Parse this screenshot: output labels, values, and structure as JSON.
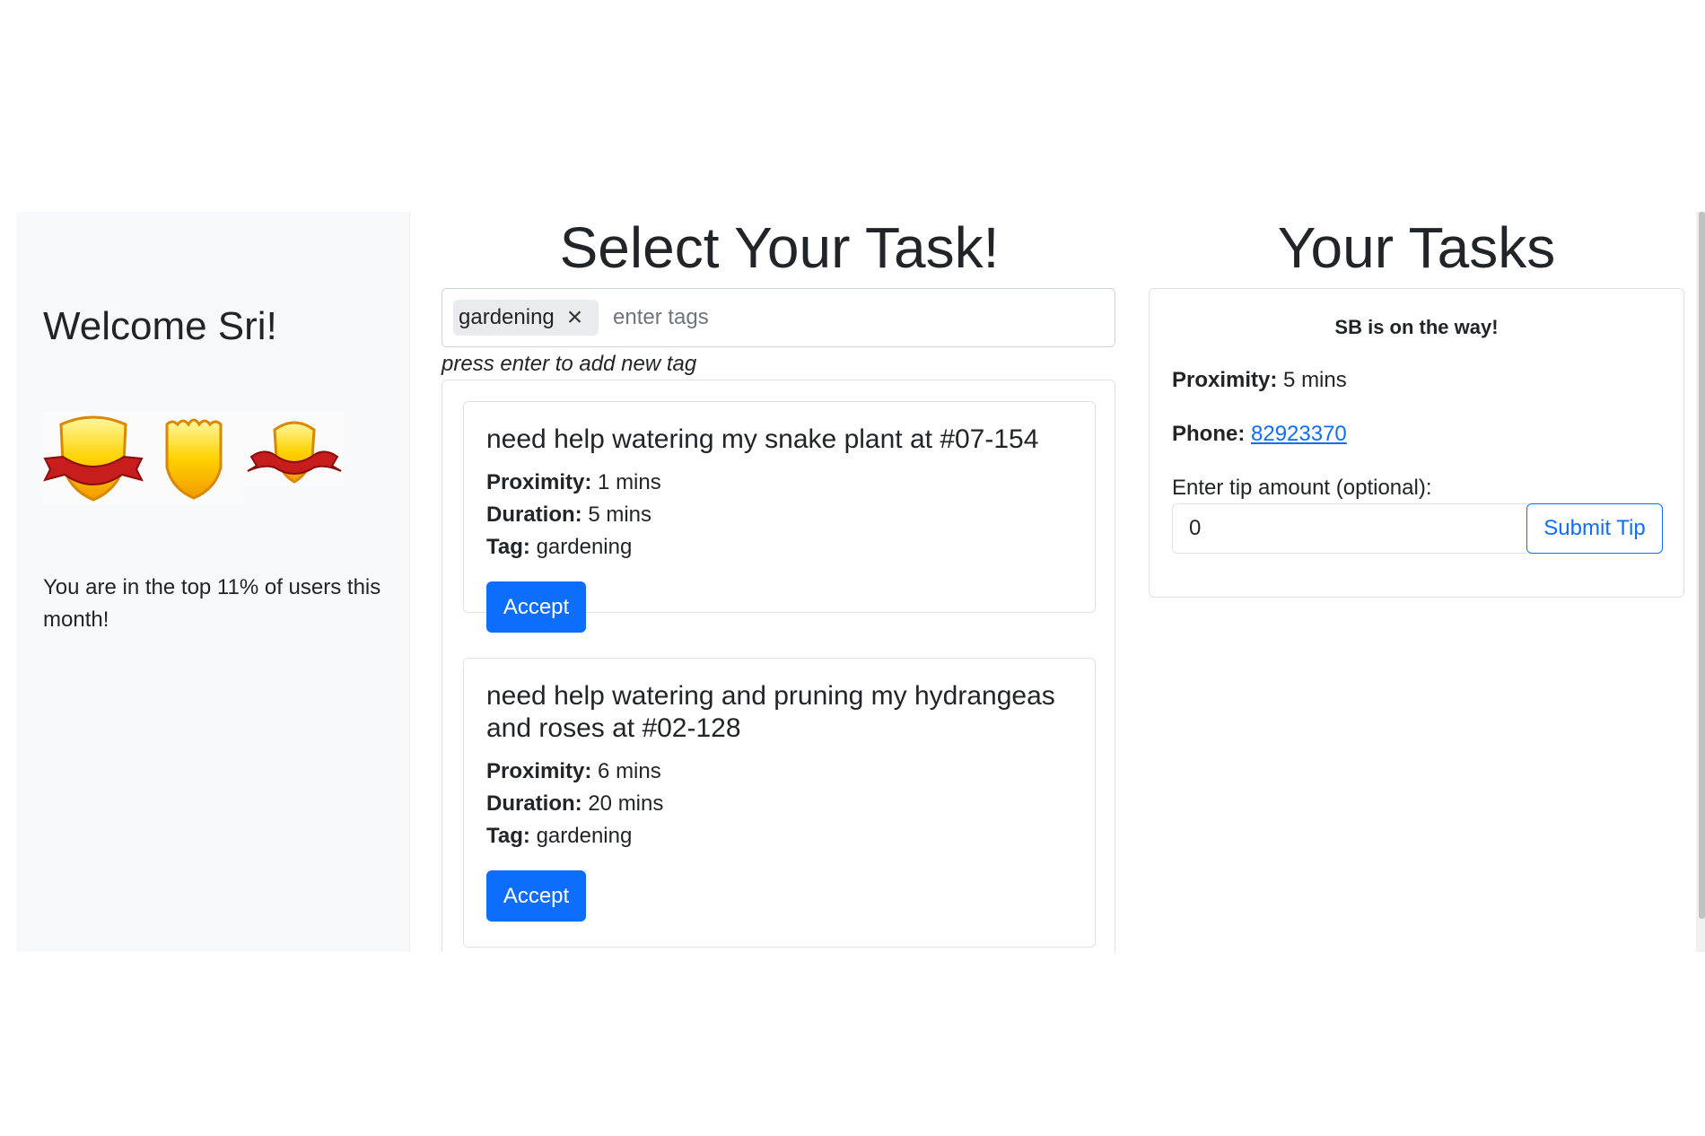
{
  "sidebar": {
    "welcome": "Welcome Sri!",
    "badges": [
      "gold-shield-ribbon-icon",
      "gold-shield-icon",
      "gold-shield-small-ribbon-icon"
    ],
    "rank_text": "You are in the top 11% of users this month!"
  },
  "select": {
    "title": "Select Your Task!",
    "tag_chip": "gardening",
    "tag_placeholder": "enter tags",
    "hint": "press enter to add new tag",
    "labels": {
      "proximity": "Proximity:",
      "duration": "Duration:",
      "tag": "Tag:"
    },
    "tasks": [
      {
        "title": "need help watering my snake plant at #07-154",
        "proximity": "1 mins",
        "duration": "5 mins",
        "tag": "gardening",
        "button": "Accept"
      },
      {
        "title": "need help watering and pruning my hydrangeas and roses at #02-128",
        "proximity": "6 mins",
        "duration": "20 mins",
        "tag": "gardening",
        "button": "Accept"
      }
    ]
  },
  "your_tasks": {
    "title": "Your Tasks",
    "status": "SB is on the way!",
    "proximity_label": "Proximity:",
    "proximity_value": "5 mins",
    "phone_label": "Phone:",
    "phone_value": "82923370",
    "tip_label": "Enter tip amount (optional):",
    "tip_value": "0",
    "submit_label": "Submit Tip"
  },
  "colors": {
    "primary": "#0d6efd",
    "sidebar_bg": "#f8f9fa",
    "chip_bg": "#e9ecef"
  }
}
